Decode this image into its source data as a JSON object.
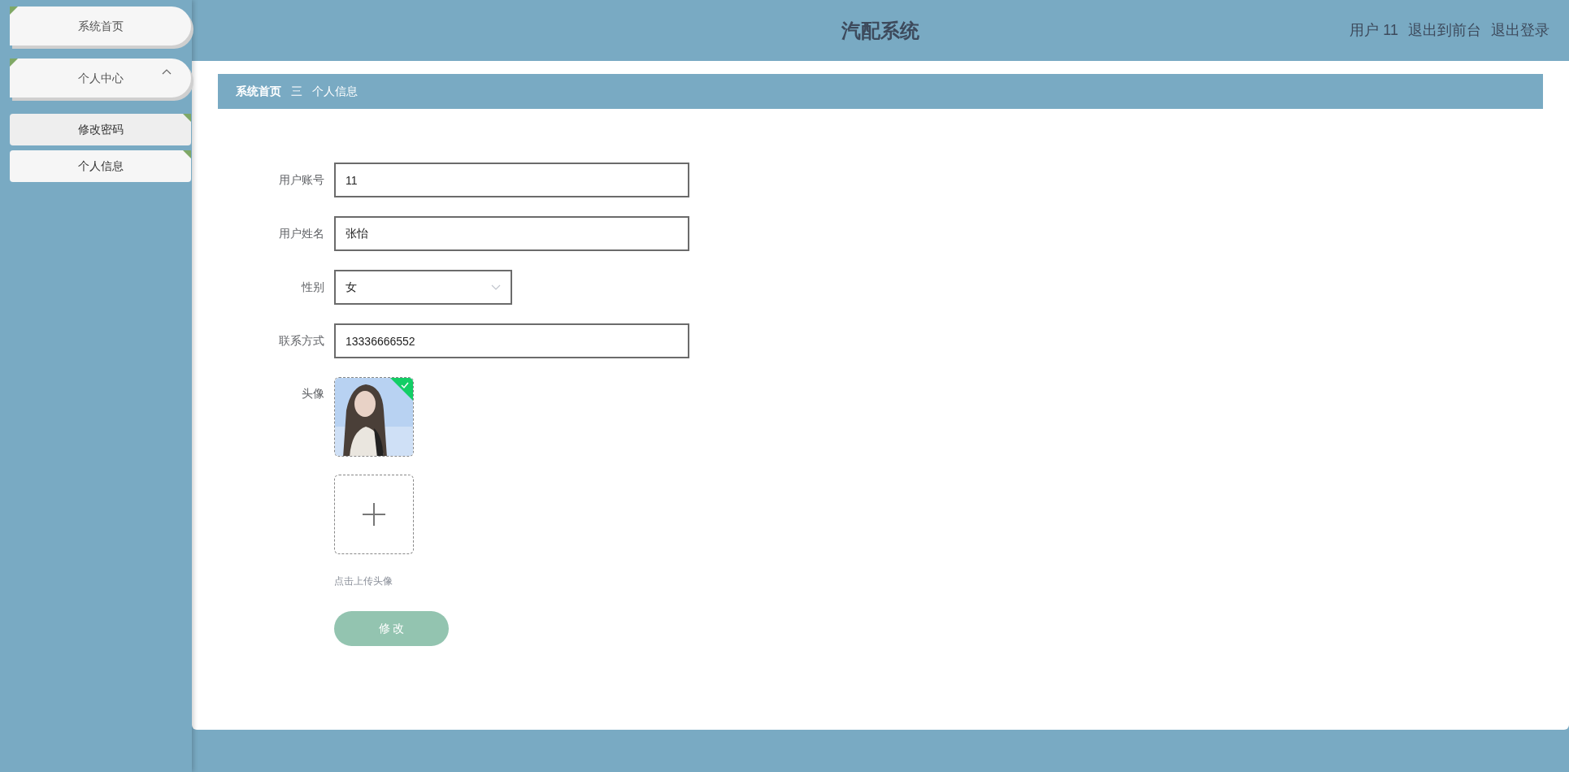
{
  "sidebar": {
    "items": [
      {
        "kind": "link",
        "label": "系统首页"
      },
      {
        "kind": "menu",
        "label": "个人中心",
        "expanded": true,
        "children": [
          {
            "label": "修改密码"
          },
          {
            "label": "个人信息"
          }
        ]
      }
    ]
  },
  "header": {
    "title": "汽配系统",
    "user": "用户 11",
    "links": [
      "退出到前台",
      "退出登录"
    ]
  },
  "breadcrumb": {
    "items": [
      "系统首页",
      "个人信息"
    ],
    "separator": "三"
  },
  "form": {
    "fields": [
      {
        "kind": "text",
        "label": "用户账号",
        "value": "11"
      },
      {
        "kind": "text",
        "label": "用户姓名",
        "value": "张怡"
      },
      {
        "kind": "select",
        "label": "性别",
        "value": "女"
      },
      {
        "kind": "text",
        "label": "联系方式",
        "value": "13336666552"
      }
    ],
    "avatar": {
      "label": "头像",
      "hint": "点击上传头像"
    },
    "submit": "修 改"
  }
}
